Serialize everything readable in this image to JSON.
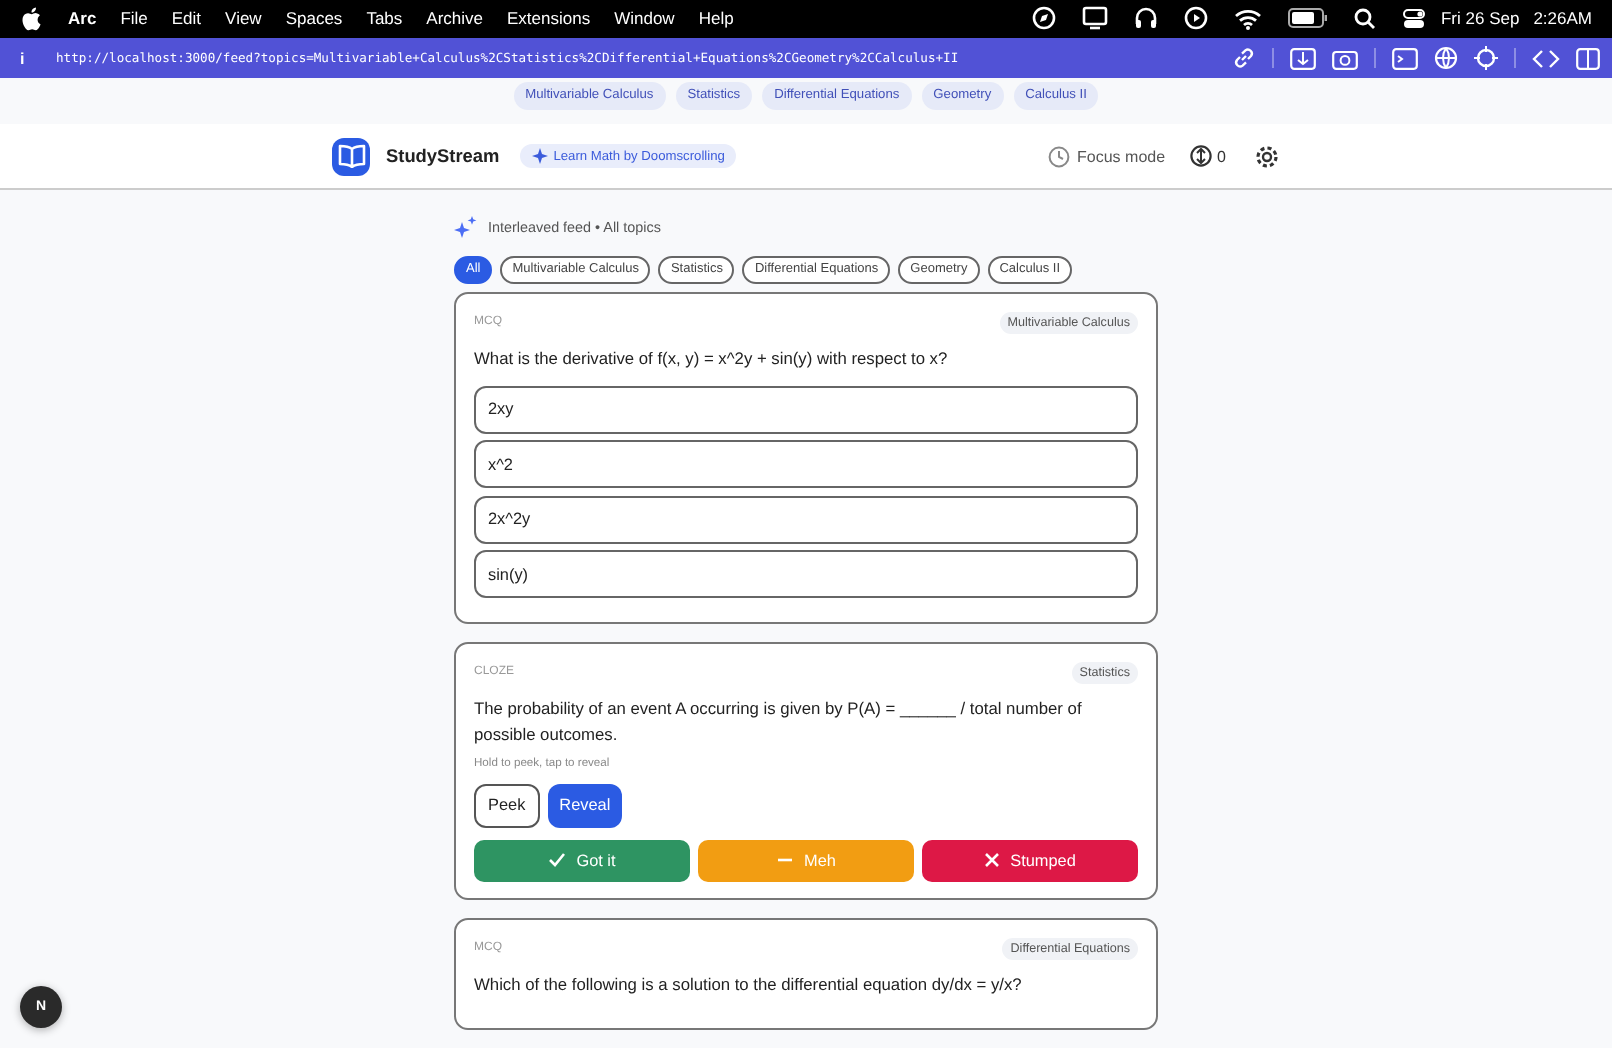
{
  "menubar": {
    "app": "Arc",
    "menus": [
      "File",
      "Edit",
      "View",
      "Spaces",
      "Tabs",
      "Archive",
      "Extensions",
      "Window",
      "Help"
    ],
    "date": "Fri 26 Sep",
    "time": "2:26AM"
  },
  "address_bar": {
    "info": "i",
    "url": "http://localhost:3000/feed?topics=Multivariable+Calculus%2CStatistics%2CDifferential+Equations%2CGeometry%2CCalculus+II"
  },
  "topic_links": [
    "Multivariable Calculus",
    "Statistics",
    "Differential Equations",
    "Geometry",
    "Calculus II"
  ],
  "header": {
    "brand": "StudyStream",
    "tagline": "Learn Math by Doomscrolling",
    "focus": "Focus mode",
    "count": "0"
  },
  "feed": {
    "heading": "Interleaved feed • All topics",
    "filters": [
      {
        "label": "All",
        "selected": true
      },
      {
        "label": "Multivariable Calculus",
        "selected": false
      },
      {
        "label": "Statistics",
        "selected": false
      },
      {
        "label": "Differential Equations",
        "selected": false
      },
      {
        "label": "Geometry",
        "selected": false
      },
      {
        "label": "Calculus II",
        "selected": false
      }
    ],
    "cards": [
      {
        "kind": "mcq",
        "type": "MCQ",
        "topic": "Multivariable Calculus",
        "question": "What is the derivative of f(x, y) = x^2y + sin(y) with respect to x?",
        "options": [
          "2xy",
          "x^2",
          "2x^2y",
          "sin(y)"
        ]
      },
      {
        "kind": "cloze",
        "type": "CLOZE",
        "topic": "Statistics",
        "question": "The probability of an event A occurring is given by P(A) = ______ / total number of possible outcomes.",
        "hint": "Hold to peek, tap to reveal",
        "peek": "Peek",
        "reveal": "Reveal",
        "ratings": [
          {
            "kind": "good",
            "label": "Got it"
          },
          {
            "kind": "ok",
            "label": "Meh"
          },
          {
            "kind": "bad",
            "label": "Stumped"
          }
        ]
      },
      {
        "kind": "mcq",
        "type": "MCQ",
        "topic": "Differential Equations",
        "question": "Which of the following is a solution to the differential equation dy/dx = y/x?"
      }
    ]
  },
  "dev_badge": "N"
}
